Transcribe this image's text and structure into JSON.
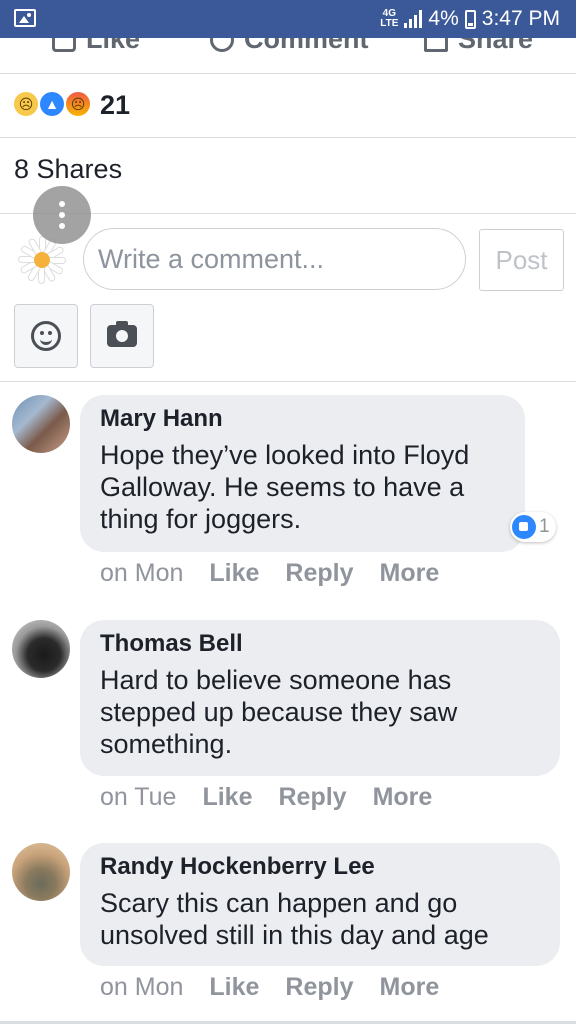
{
  "status_bar": {
    "network": "4G",
    "network_sub": "LTE",
    "battery": "4%",
    "time": "3:47 PM"
  },
  "actions": {
    "like": "Like",
    "comment": "Comment",
    "share": "Share"
  },
  "reactions": {
    "icons": [
      "sad-reaction-icon",
      "like-reaction-icon",
      "angry-reaction-icon"
    ],
    "count": "21"
  },
  "shares": {
    "label": "8 Shares"
  },
  "composer": {
    "placeholder": "Write a comment...",
    "post_label": "Post"
  },
  "comments": [
    {
      "name": "Mary Hann",
      "text": "Hope they’ve looked into Floyd Galloway. He seems to have a thing for joggers.",
      "time": "on Mon",
      "like": "Like",
      "reply": "Reply",
      "more": "More",
      "like_count": "1"
    },
    {
      "name": "Thomas Bell",
      "text": "Hard to believe someone has stepped up because they saw something.",
      "time": "on Tue",
      "like": "Like",
      "reply": "Reply",
      "more": "More"
    },
    {
      "name": "Randy Hockenberry Lee",
      "text": "Scary this can happen and go unsolved still in this day and age",
      "time": "on Mon",
      "like": "Like",
      "reply": "Reply",
      "more": "More"
    }
  ],
  "colors": {
    "status_bar": "#3b5998",
    "bubble": "#ebedf0",
    "meta_text": "#90949c",
    "like_blue": "#2d88ff"
  }
}
